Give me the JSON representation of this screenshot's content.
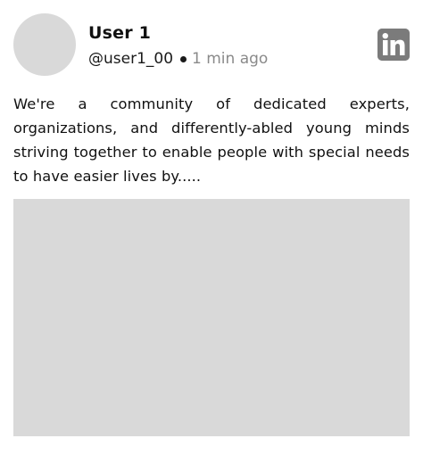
{
  "post": {
    "user_name": "User 1",
    "handle": "@user1_00",
    "timestamp": "1 min ago",
    "text": "We're a community of dedicated experts, organizations, and differently-abled young minds striving together to enable people with special needs to have easier lives by.....",
    "share_icon": "linkedin-icon"
  },
  "colors": {
    "placeholder": "#d9d9d9",
    "icon": "#7b7b7b",
    "muted_text": "#8a8a8a"
  }
}
